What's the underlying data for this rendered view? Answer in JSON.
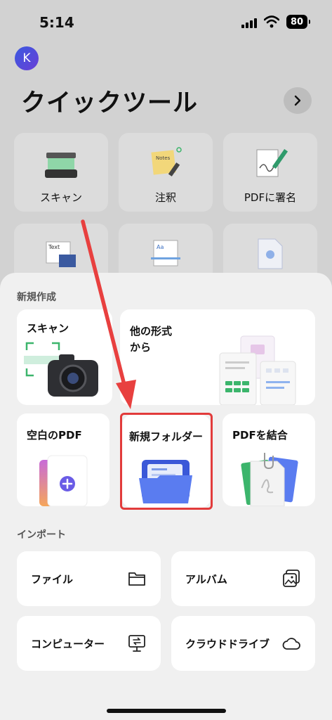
{
  "status": {
    "time": "5:14",
    "battery": "80"
  },
  "avatar": {
    "initial": "K"
  },
  "quick_tools": {
    "title": "クイックツール",
    "items": [
      {
        "label": "スキャン",
        "icon": "scanner-icon"
      },
      {
        "label": "注釈",
        "icon": "sticky-note-icon"
      },
      {
        "label": "PDFに署名",
        "icon": "signature-icon"
      },
      {
        "label": "",
        "icon": "text-image-icon"
      },
      {
        "label": "",
        "icon": "scan-document-icon"
      },
      {
        "label": "",
        "icon": "image-file-icon"
      }
    ]
  },
  "create": {
    "label": "新規作成",
    "scan": "スキャン",
    "other_format": "他の形式\nから",
    "blank_pdf": "空白のPDF",
    "new_folder": "新規フォルダー",
    "merge_pdf": "PDFを結合"
  },
  "import": {
    "label": "インポート",
    "file": "ファイル",
    "album": "アルバム",
    "computer": "コンピューター",
    "cloud": "クラウドドライブ"
  },
  "colors": {
    "accent": "#4a6df0",
    "highlight": "#e23b3b",
    "arrow": "#e8403f"
  }
}
